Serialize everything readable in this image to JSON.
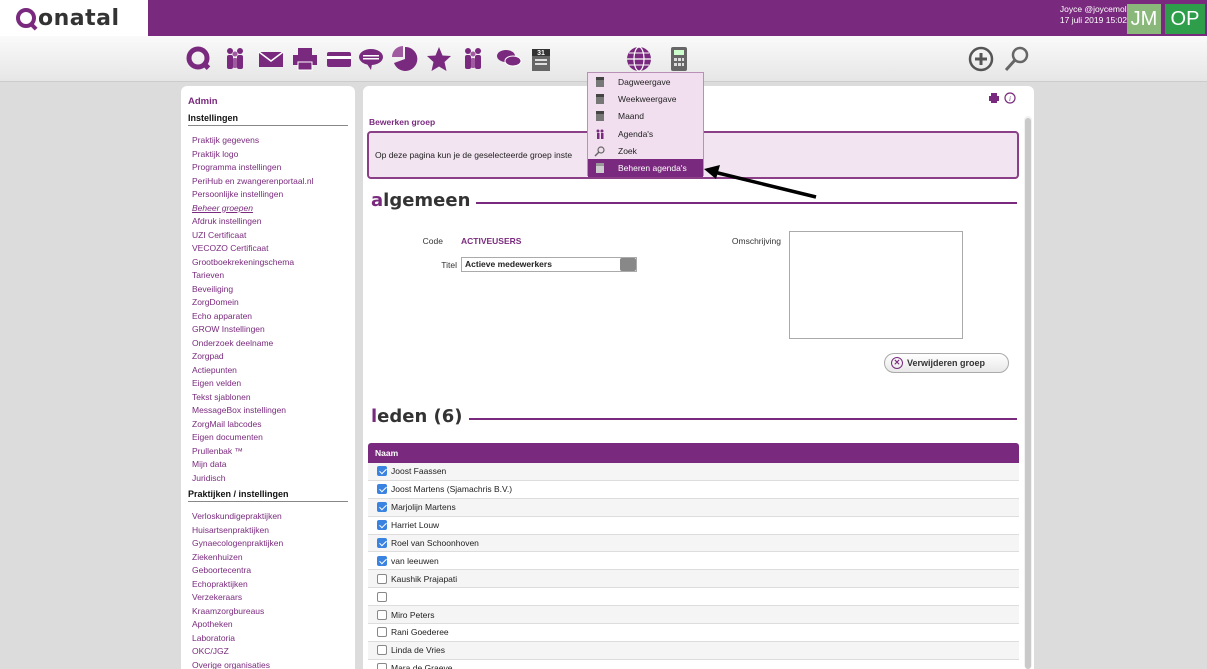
{
  "header": {
    "logo_text": "onatal",
    "user_line1": "Joyce @joycemol",
    "user_line2": "17 juli 2019 15:02",
    "avatar1": "JM",
    "avatar2": "OP"
  },
  "toolbar": {
    "icons": [
      "onatal-home-icon",
      "people-icon",
      "mail-icon",
      "printer-icon",
      "card-icon",
      "chat-bubble-icon",
      "pie-chart-icon",
      "star-icon",
      "group-icon",
      "chat-icon",
      "calendar-icon",
      "globe-icon",
      "calculator-icon",
      "plus-circle-icon",
      "search-icon"
    ],
    "calendar_day": "31"
  },
  "dropdown": {
    "items": [
      {
        "label": "Dagweergave",
        "icon": "calendar-day-icon"
      },
      {
        "label": "Weekweergave",
        "icon": "calendar-week-icon"
      },
      {
        "label": "Maand",
        "icon": "calendar-month-icon"
      },
      {
        "label": "Agenda's",
        "icon": "people-icon"
      },
      {
        "label": "Zoek",
        "icon": "search-icon"
      },
      {
        "label": "Beheren agenda's",
        "icon": "calendar-manage-icon"
      }
    ],
    "active_index": 5
  },
  "sidebar": {
    "admin": "Admin",
    "section1": "Instellingen",
    "links1": [
      "Praktijk gegevens",
      "Praktijk logo",
      "Programma instellingen",
      "PeriHub en zwangerenportaal.nl",
      "Persoonlijke instellingen",
      "Beheer groepen",
      "Afdruk instellingen",
      "UZI Certificaat",
      "VECOZO Certificaat",
      "Grootboekrekeningschema",
      "Tarieven",
      "Beveiliging",
      "ZorgDomein",
      "Echo apparaten",
      "GROW Instellingen",
      "Onderzoek deelname",
      "Zorgpad",
      "Actiepunten",
      "Eigen velden",
      "Tekst sjablonen",
      "MessageBox instellingen",
      "ZorgMail labcodes",
      "Eigen documenten",
      "Prullenbak ™",
      "Mijn data",
      "Juridisch"
    ],
    "current_link": "Beheer groepen",
    "section2": "Praktijken / instellingen",
    "links2": [
      "Verloskundigepraktijken",
      "Huisartsenpraktijken",
      "Gynaecologenpraktijken",
      "Ziekenhuizen",
      "Geboortecentra",
      "Echopraktijken",
      "Verzekeraars",
      "Kraamzorgbureaus",
      "Apotheken",
      "Laboratoria",
      "OKC/JGZ",
      "Overige organisaties"
    ]
  },
  "main": {
    "page_label": "Bewerken groep",
    "info_text": "Op deze pagina kun je de geselecteerde groep inste",
    "section1_first": "a",
    "section1_rest": "lgemeen",
    "code_label": "Code",
    "code_value": "ACTIVEUSERS",
    "titel_label": "Titel",
    "titel_value": "Actieve medewerkers",
    "omschrijving_label": "Omschrijving",
    "delete_button": "Verwijderen groep",
    "section2_first": "l",
    "section2_rest": "eden (6)",
    "table_header": "Naam",
    "members": [
      {
        "name": "Joost Faassen",
        "checked": true
      },
      {
        "name": "Joost Martens (Sjamachris B.V.)",
        "checked": true
      },
      {
        "name": "Marjolijn Martens",
        "checked": true
      },
      {
        "name": "Harriet Louw",
        "checked": true
      },
      {
        "name": "Roel van Schoonhoven",
        "checked": true
      },
      {
        "name": "van leeuwen",
        "checked": true
      },
      {
        "name": "Kaushik Prajapati",
        "checked": false
      },
      {
        "name": "",
        "checked": false
      },
      {
        "name": "Miro Peters",
        "checked": false
      },
      {
        "name": "Rani Goederee",
        "checked": false
      },
      {
        "name": "Linda de Vries",
        "checked": false
      },
      {
        "name": "Mara de Graeve",
        "checked": false
      }
    ]
  },
  "colors": {
    "brand": "#7a2a7e",
    "checkbox": "#3a83e0",
    "avatar1": "#8ab87a",
    "avatar2": "#2e9e4a"
  }
}
